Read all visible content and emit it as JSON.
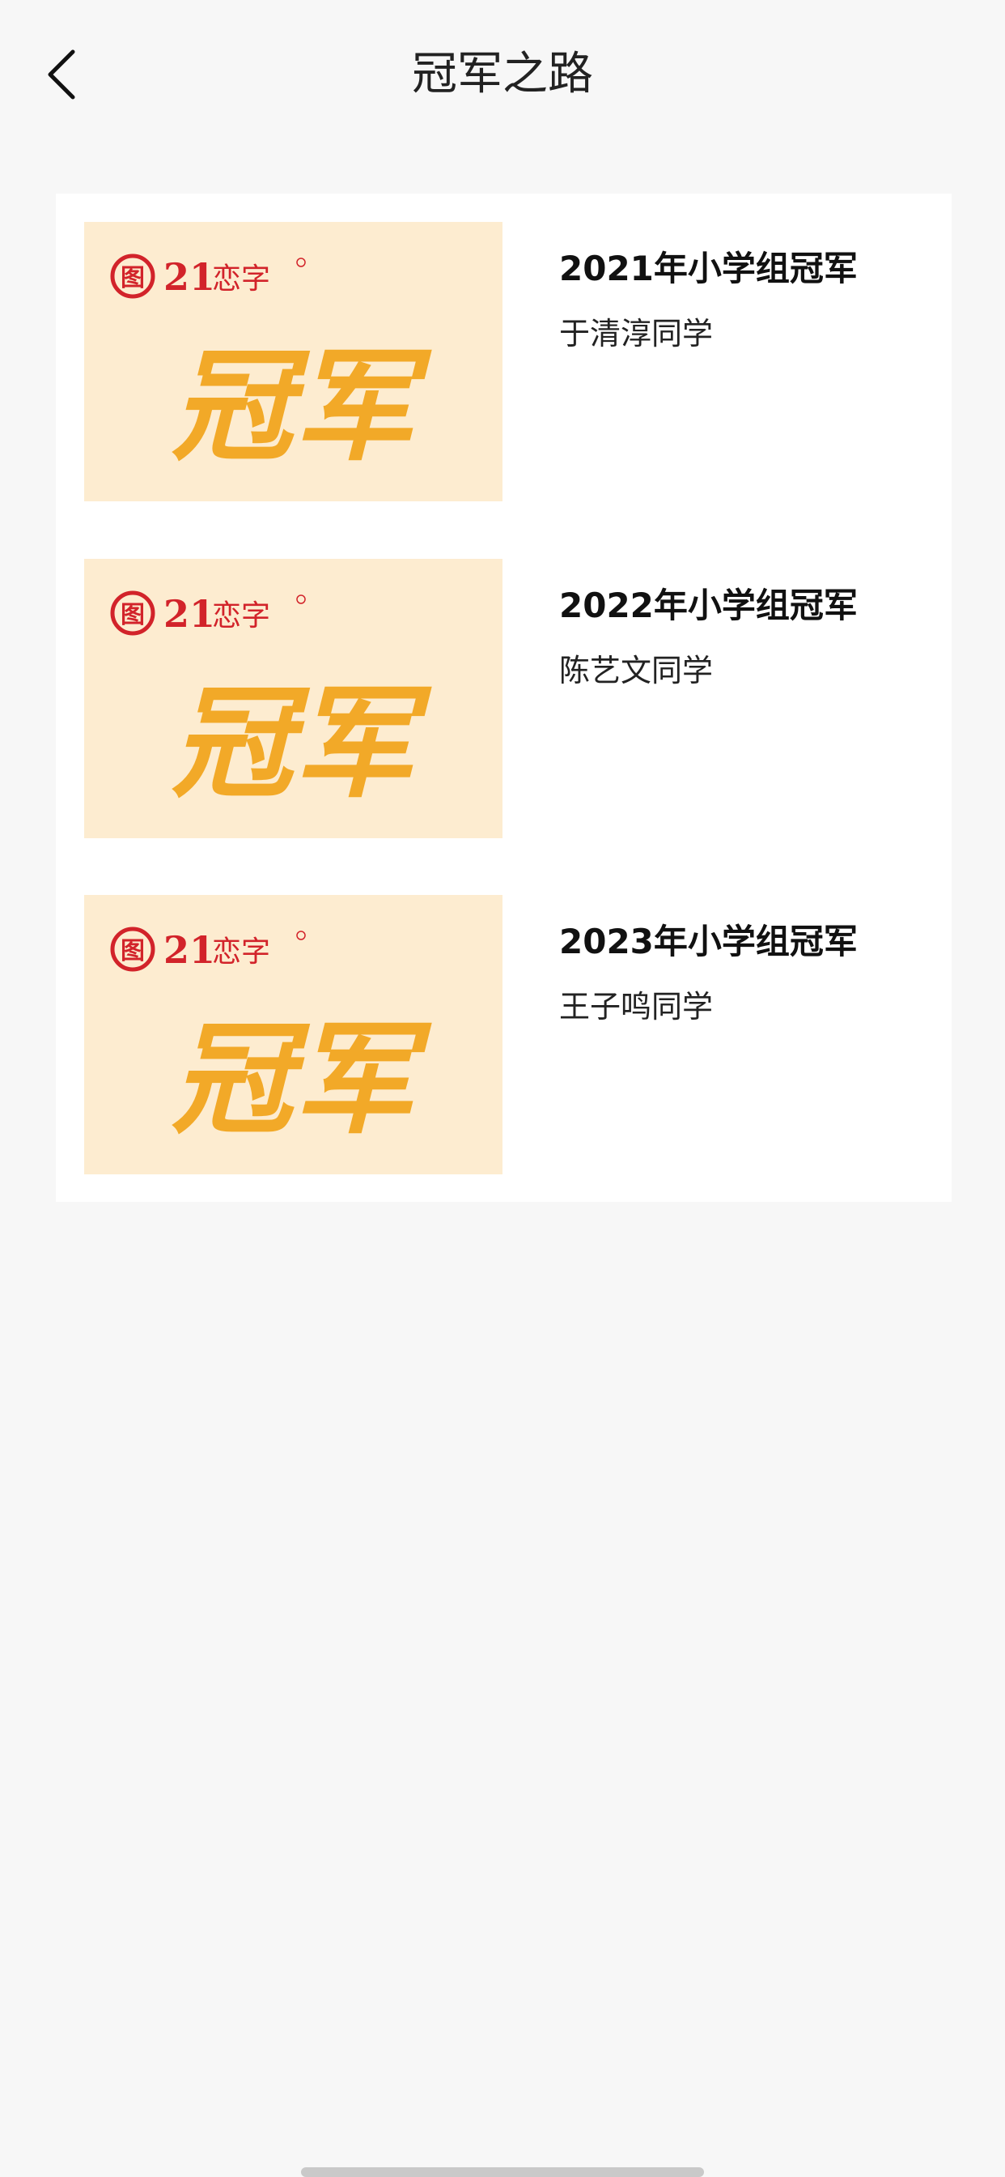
{
  "header": {
    "title": "冠军之路",
    "back_icon": "chevron-left-icon"
  },
  "list": {
    "items": [
      {
        "title": "2021年小学组冠军",
        "subtitle": "于清淳同学",
        "thumb": {
          "brand": "21",
          "brand_suffix": "恋字",
          "logo_mark": "图",
          "headline": "冠军"
        }
      },
      {
        "title": "2022年小学组冠军",
        "subtitle": "陈艺文同学",
        "thumb": {
          "brand": "21",
          "brand_suffix": "恋字",
          "logo_mark": "图",
          "headline": "冠军"
        }
      },
      {
        "title": "2023年小学组冠军",
        "subtitle": "王子鸣同学",
        "thumb": {
          "brand": "21",
          "brand_suffix": "恋字",
          "logo_mark": "图",
          "headline": "冠军"
        }
      }
    ]
  },
  "colors": {
    "background": "#f7f7f7",
    "card": "#ffffff",
    "thumb_bg": "#fdecd0",
    "brand_red": "#d2232a",
    "gold": "#f2a928"
  }
}
